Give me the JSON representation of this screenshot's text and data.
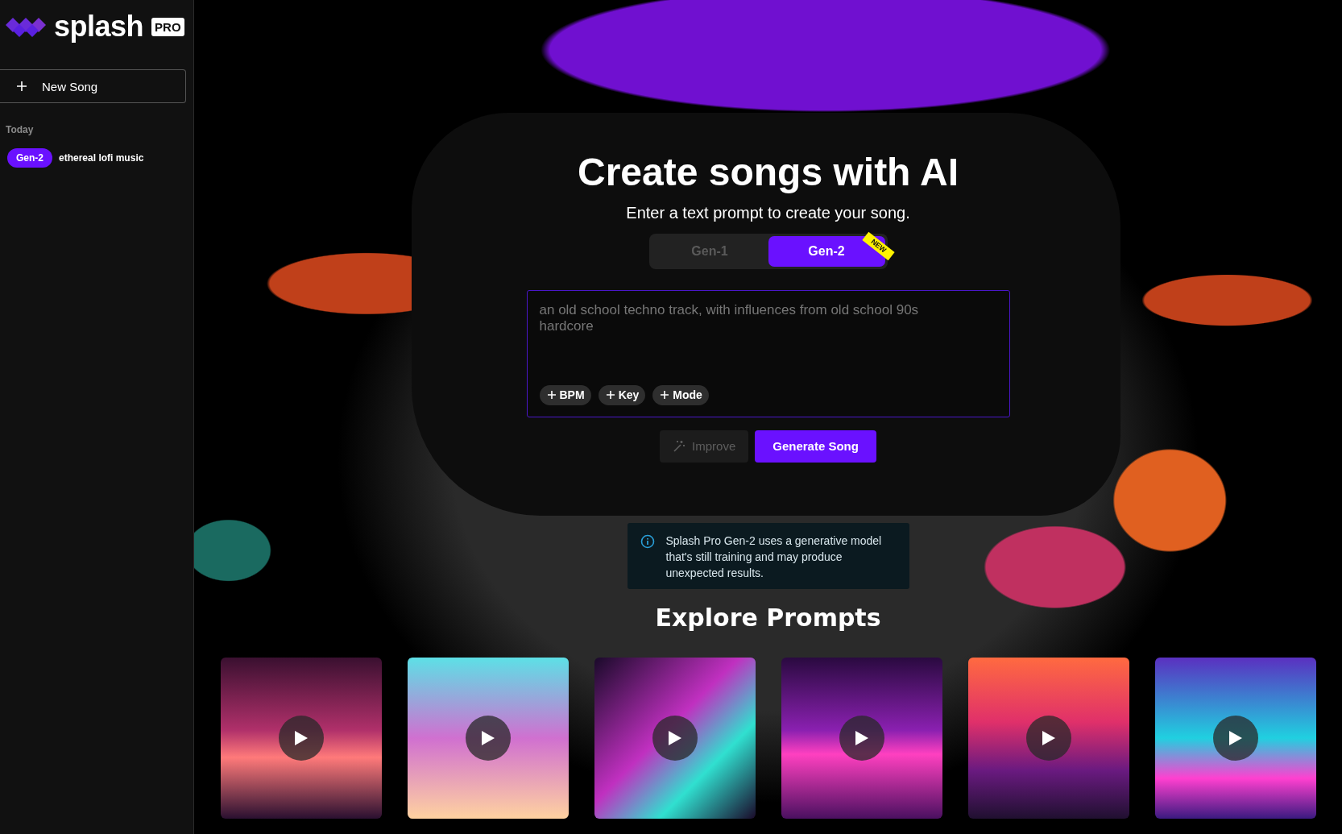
{
  "brand": {
    "name": "splash",
    "badge": "PRO"
  },
  "sidebar": {
    "new_button": "New Song",
    "sections": [
      {
        "heading": "Today",
        "items": [
          {
            "tag": "Gen-2",
            "title": "ethereal lofi music"
          }
        ]
      }
    ]
  },
  "hero": {
    "title": "Create songs with AI",
    "subtitle": "Enter a text prompt to create your song.",
    "model_tabs": [
      {
        "label": "Gen-1",
        "selected": false
      },
      {
        "label": "Gen-2",
        "selected": true,
        "ribbon": "NEW"
      }
    ],
    "prompt": {
      "placeholder": "an old school techno track, with influences from old school 90s hardcore",
      "chips": [
        "BPM",
        "Key",
        "Mode"
      ]
    },
    "buttons": [
      {
        "label": "Improve",
        "kind": "improve",
        "disabled": true
      },
      {
        "label": "Generate Song",
        "kind": "generate",
        "disabled": false
      }
    ]
  },
  "notice": "Splash Pro Gen-2 uses a generative model that's still training and may produce unexpected results.",
  "explore": {
    "title": "Explore Prompts"
  }
}
